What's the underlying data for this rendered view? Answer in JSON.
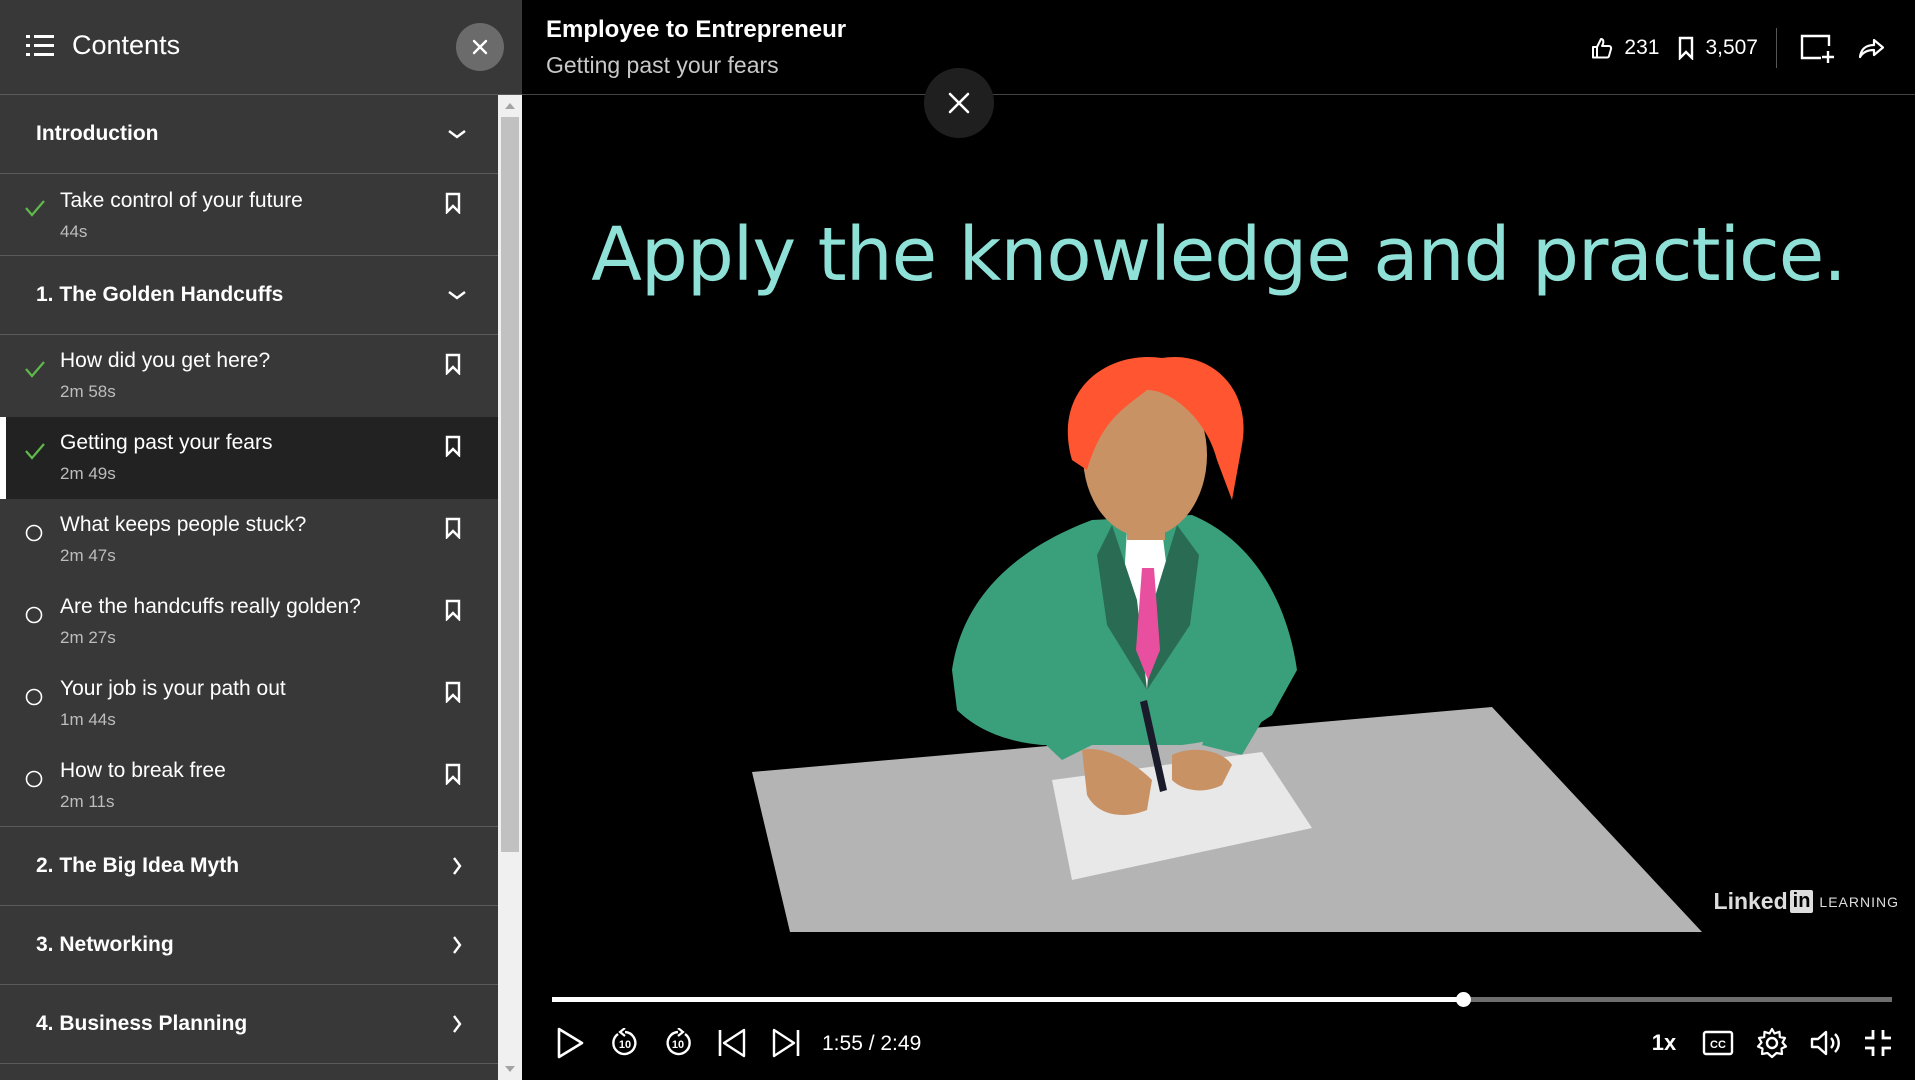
{
  "sidebar": {
    "title": "Contents",
    "sections_top": [
      {
        "title": "Introduction",
        "expanded": true,
        "items": [
          {
            "name": "Take control of your future",
            "duration": "44s",
            "status": "done"
          }
        ]
      },
      {
        "title": "1. The Golden Handcuffs",
        "expanded": true,
        "items": [
          {
            "name": "How did you get here?",
            "duration": "2m 58s",
            "status": "done"
          },
          {
            "name": "Getting past your fears",
            "duration": "2m 49s",
            "status": "done",
            "active": true
          },
          {
            "name": "What keeps people stuck?",
            "duration": "2m 47s",
            "status": "todo"
          },
          {
            "name": "Are the handcuffs really golden?",
            "duration": "2m 27s",
            "status": "todo"
          },
          {
            "name": "Your job is your path out",
            "duration": "1m 44s",
            "status": "todo"
          },
          {
            "name": "How to break free",
            "duration": "2m 11s",
            "status": "todo"
          }
        ]
      }
    ],
    "collapsed_sections": [
      "2. The Big Idea Myth",
      "3. Networking",
      "4. Business Planning"
    ]
  },
  "player": {
    "course_title": "Employee to Entrepreneur",
    "video_title": "Getting past your fears",
    "likes": "231",
    "saves": "3,507",
    "slide_text": "Apply the knowledge and practice.",
    "brand": {
      "linked": "Linked",
      "in": "in",
      "learning": "LEARNING"
    },
    "time_current": "1:55",
    "time_total": "2:49",
    "time_display": "1:55 / 2:49",
    "progress_fraction": 0.68,
    "speed": "1x"
  },
  "colors": {
    "done_check": "#5fb94a",
    "slide_text": "#8fe1d8"
  }
}
